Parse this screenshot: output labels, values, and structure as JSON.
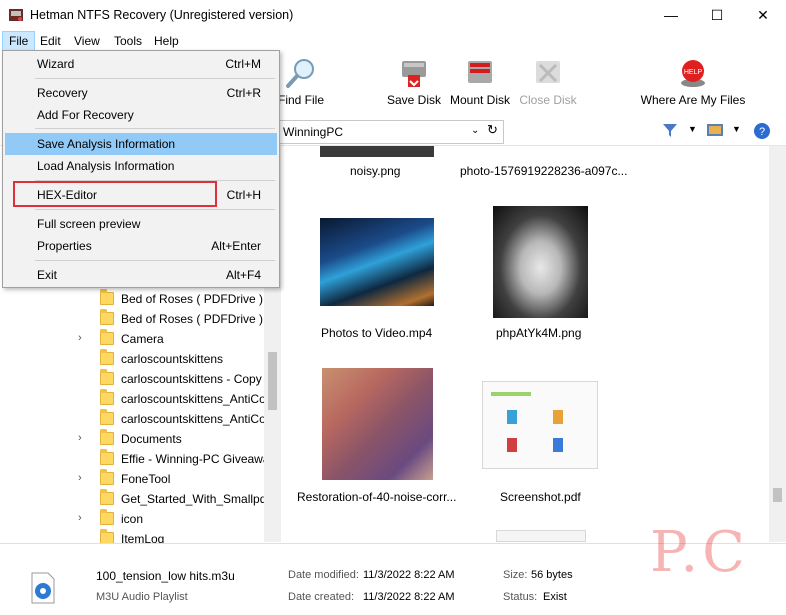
{
  "window": {
    "title": "Hetman NTFS Recovery (Unregistered version)",
    "minimize": "—",
    "maximize": "☐",
    "close": "✕"
  },
  "menubar": {
    "file": "File",
    "edit": "Edit",
    "view": "View",
    "tools": "Tools",
    "help": "Help"
  },
  "toolbar": {
    "find_file": "Find File",
    "save_disk": "Save Disk",
    "mount_disk": "Mount Disk",
    "close_disk": "Close Disk",
    "where_are_my_files": "Where Are My Files",
    "where_icon_text": "HELP"
  },
  "address": {
    "path": "WinningPC",
    "dropdown_glyph": "⌄",
    "refresh_glyph": "↻"
  },
  "file_menu": {
    "items": [
      {
        "label": "Wizard",
        "shortcut": "Ctrl+M"
      },
      {
        "label": "Recovery",
        "shortcut": "Ctrl+R"
      },
      {
        "label": "Add For Recovery",
        "shortcut": ""
      },
      {
        "label": "Save Analysis Information",
        "shortcut": ""
      },
      {
        "label": "Load Analysis Information",
        "shortcut": ""
      },
      {
        "label": "HEX-Editor",
        "shortcut": "Ctrl+H"
      },
      {
        "label": "Full screen preview",
        "shortcut": ""
      },
      {
        "label": "Properties",
        "shortcut": "Alt+Enter"
      },
      {
        "label": "Exit",
        "shortcut": "Alt+F4"
      }
    ]
  },
  "tree": {
    "items": [
      {
        "label": "Bed of Roses ( PDFDrive )",
        "expandable": false
      },
      {
        "label": "Bed of Roses ( PDFDrive ) -",
        "expandable": false
      },
      {
        "label": "Camera",
        "expandable": true
      },
      {
        "label": "carloscountskittens",
        "expandable": false
      },
      {
        "label": "carloscountskittens - Copy",
        "expandable": false
      },
      {
        "label": "carloscountskittens_AntiCo",
        "expandable": false
      },
      {
        "label": "carloscountskittens_AntiCo",
        "expandable": false
      },
      {
        "label": "Documents",
        "expandable": true
      },
      {
        "label": "Effie - Winning-PC Giveawa",
        "expandable": false
      },
      {
        "label": "FoneTool",
        "expandable": true
      },
      {
        "label": "Get_Started_With_Smallpdf",
        "expandable": false
      },
      {
        "label": "icon",
        "expandable": true
      },
      {
        "label": "ItemLog",
        "expandable": false
      }
    ]
  },
  "files": [
    {
      "name": "noisy.png"
    },
    {
      "name": "photo-1576919228236-a097c..."
    },
    {
      "name": "Photos to Video.mp4"
    },
    {
      "name": "phpAtYk4M.png"
    },
    {
      "name": "Restoration-of-40-noise-corr..."
    },
    {
      "name": "Screenshot.pdf"
    }
  ],
  "status": {
    "file_name": "100_tension_low hits.m3u",
    "file_type": "M3U Audio Playlist",
    "modified_label": "Date modified:",
    "modified_value": "11/3/2022 8:22 AM",
    "created_label": "Date created:",
    "created_value": "11/3/2022 8:22 AM",
    "size_label": "Size:",
    "size_value": "56 bytes",
    "status_label": "Status:",
    "status_value": "Exist"
  },
  "watermark": "P.C",
  "colors": {
    "menu_highlight": "#91c9f7",
    "annotation_red": "#e0303a"
  }
}
